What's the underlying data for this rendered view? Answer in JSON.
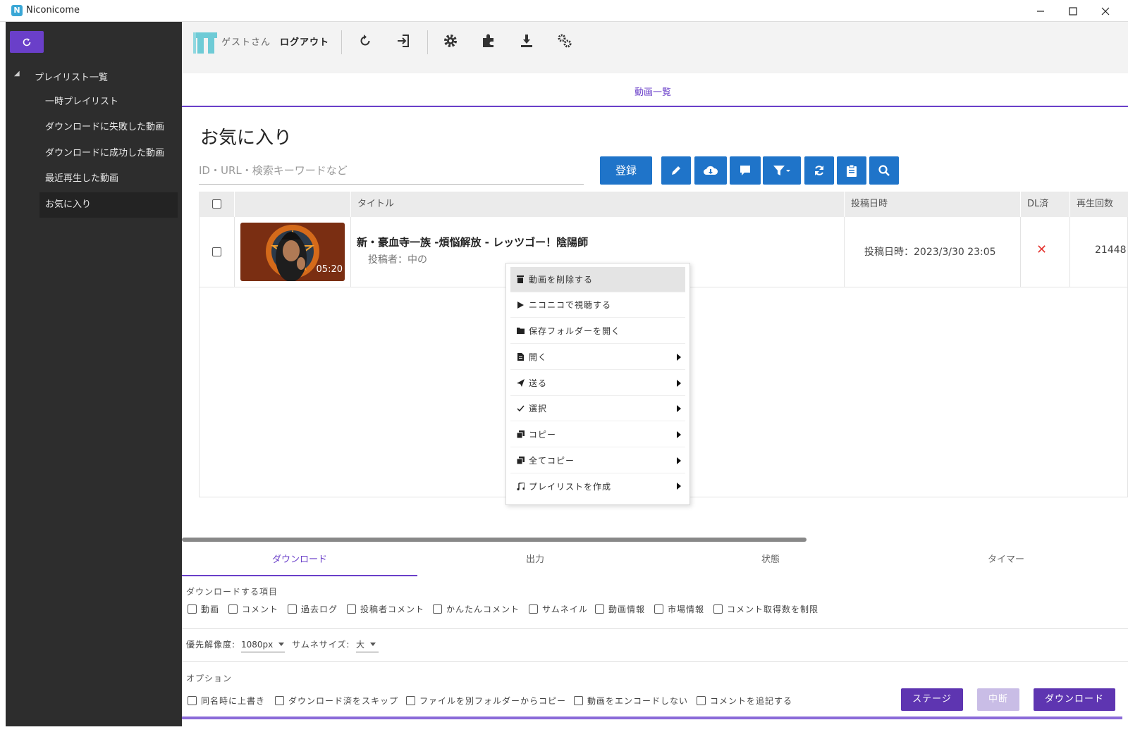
{
  "window": {
    "title": "Niconicome",
    "app_icon": "N"
  },
  "sidebar": {
    "refresh_icon": "refresh-icon",
    "root": "プレイリスト一覧",
    "items": [
      {
        "label": "一時プレイリスト",
        "selected": false
      },
      {
        "label": "ダウンロードに失敗した動画",
        "selected": false
      },
      {
        "label": "ダウンロードに成功した動画",
        "selected": false
      },
      {
        "label": "最近再生した動画",
        "selected": false
      },
      {
        "label": "お気に入り",
        "selected": true
      }
    ]
  },
  "toolbar": {
    "guest": "ゲストさん",
    "logout": "ログアウト",
    "icons": [
      "undo-icon",
      "login-icon",
      "settings-icon",
      "plugin-icon",
      "download-icon",
      "gears-icon"
    ]
  },
  "tabs": {
    "videos": "動画一覧"
  },
  "playlist": {
    "title": "お気に入り",
    "search_placeholder": "ID・URL・検索キーワードなど",
    "register": "登録",
    "action_icons": [
      "edit-icon",
      "cloud-download-icon",
      "comment-icon",
      "filter-icon",
      "sync-icon",
      "clipboard-icon",
      "search-icon"
    ]
  },
  "table": {
    "headers": {
      "title": "タイトル",
      "posted": "投稿日時",
      "dl": "DL済",
      "views": "再生回数"
    },
    "rows": [
      {
        "duration": "05:20",
        "title": "新・豪血寺一族 -煩悩解放 - レッツゴー！陰陽師",
        "uploader": "投稿者：中の",
        "posted": "投稿日時：2023/3/30 23:05",
        "downloaded": "✕",
        "views": "21448"
      }
    ]
  },
  "context_menu": [
    {
      "label": "動画を削除する",
      "icon": "trash-icon",
      "submenu": false,
      "highlighted": true
    },
    {
      "label": "ニコニコで視聴する",
      "icon": "play-icon",
      "submenu": false,
      "highlighted": false
    },
    {
      "label": "保存フォルダーを開く",
      "icon": "folder-icon",
      "submenu": false,
      "highlighted": false
    },
    {
      "label": "開く",
      "icon": "file-icon",
      "submenu": true,
      "highlighted": false
    },
    {
      "label": "送る",
      "icon": "send-icon",
      "submenu": true,
      "highlighted": false
    },
    {
      "label": "選択",
      "icon": "check-icon",
      "submenu": true,
      "highlighted": false
    },
    {
      "label": "コピー",
      "icon": "copy-icon",
      "submenu": true,
      "highlighted": false
    },
    {
      "label": "全てコピー",
      "icon": "copy-all-icon",
      "submenu": true,
      "highlighted": false
    },
    {
      "label": "プレイリストを作成",
      "icon": "music-icon",
      "submenu": true,
      "highlighted": false
    }
  ],
  "bottom_tabs": [
    "ダウンロード",
    "出力",
    "状態",
    "タイマー"
  ],
  "download": {
    "items_label": "ダウンロードする項目",
    "items": [
      "動画",
      "コメント",
      "過去ログ",
      "投稿者コメント",
      "かんたんコメント",
      "サムネイル",
      "動画情報",
      "市場情報",
      "コメント取得数を制限"
    ],
    "resolution_label": "優先解像度:",
    "resolution": "1080px",
    "thumb_label": "サムネサイズ:",
    "thumb_size": "大",
    "options_label": "オプション",
    "options": [
      "同名時に上書き",
      "ダウンロード済をスキップ",
      "ファイルを別フォルダーからコピー",
      "動画をエンコードしない",
      "コメントを追記する"
    ],
    "stage": "ステージ",
    "cancel": "中断",
    "download": "ダウンロード"
  },
  "colors": {
    "accent": "#6a3fc9",
    "blue": "#1f74c9",
    "sidebar": "#2d2d2d",
    "error": "#e53935"
  }
}
